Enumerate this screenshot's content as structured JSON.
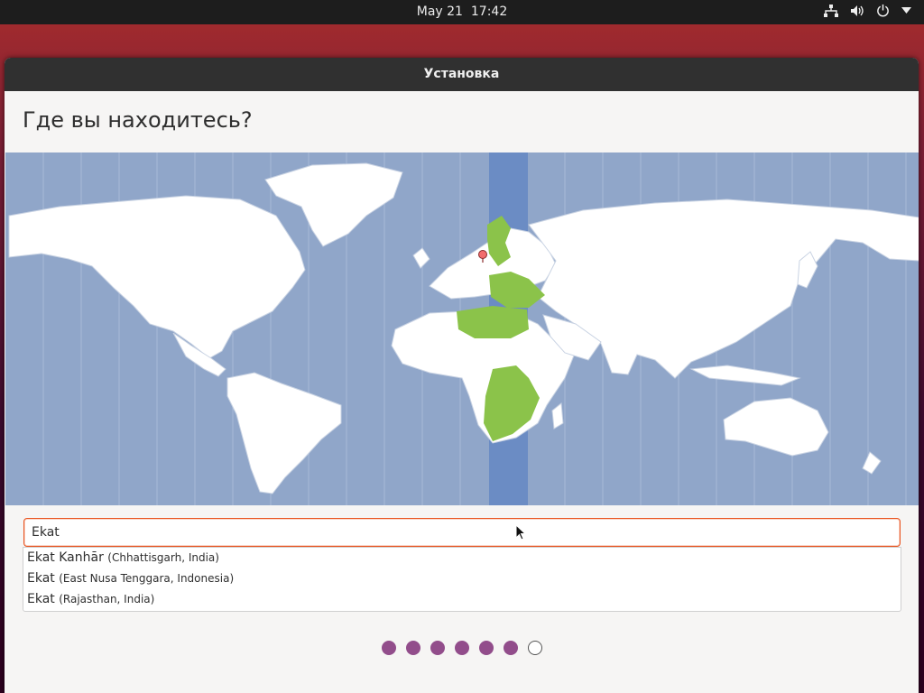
{
  "topbar": {
    "date": "May 21",
    "time": "17:42",
    "icons": [
      "network-icon",
      "volume-icon",
      "power-icon",
      "dropdown-arrow-icon"
    ]
  },
  "window": {
    "title": "Установка",
    "heading": "Где вы находитесь?"
  },
  "search": {
    "value": "Ekat"
  },
  "suggestions": [
    {
      "name": "Ekat Kanhār",
      "region": "(Chhattisgarh, India)"
    },
    {
      "name": "Ekat",
      "region": "(East Nusa Tenggara, Indonesia)"
    },
    {
      "name": "Ekat",
      "region": "(Rajasthan, India)"
    }
  ],
  "progress": {
    "total_steps": 7,
    "completed_steps": 6
  },
  "colors": {
    "accent": "#e95420",
    "ocean": "#90a6c9",
    "selected_zone": "#6b8cc4",
    "highlight_land": "#8bc34a",
    "land": "#ffffff",
    "dot_filled": "#924d8b"
  }
}
